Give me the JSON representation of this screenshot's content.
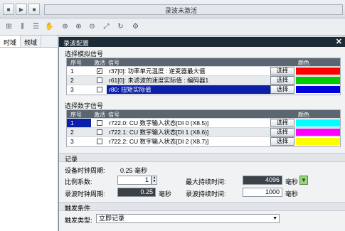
{
  "recording_status": "录波未激活",
  "left_tabs": [
    "时域",
    "频域"
  ],
  "dialog": {
    "title": "录波配置",
    "close": "✕",
    "analog": {
      "header": "选择模拟信号",
      "columns": {
        "num": "序号",
        "active": "激活",
        "signal": "信号",
        "color": "颜色"
      },
      "rows": [
        {
          "num": "1",
          "checked": "✓",
          "signal": "r37[0]: 功率单元温度 : 逆变器最大值",
          "button": "选择",
          "color": "#ff0000"
        },
        {
          "num": "2",
          "checked": "",
          "signal": "r61[0]: 未滤波的速度实际值 : 编码器1",
          "button": "选择",
          "color": "#00cc00"
        },
        {
          "num": "3",
          "checked": "",
          "signal": "r80: 扭矩实际值",
          "button": "选择",
          "color": "#0000dd"
        }
      ]
    },
    "digital": {
      "header": "选择数字信号",
      "columns": {
        "num": "序号",
        "active": "激活",
        "signal": "信号",
        "color": "颜色"
      },
      "rows": [
        {
          "num": "1",
          "checked": "",
          "signal": "r722.0: CU 数字输入状态[DI 0 (X8.5)]",
          "button": "选择",
          "color": "#00ffff"
        },
        {
          "num": "2",
          "checked": "",
          "signal": "r722.1: CU 数字输入状态[DI 1 (X8.6)]",
          "button": "选择",
          "color": "#ff00ff"
        },
        {
          "num": "3",
          "checked": "",
          "signal": "r722.2: CU 数字输入状态[DI 2 (X8.7)]",
          "button": "选择",
          "color": "#ffff00"
        }
      ]
    },
    "recording": {
      "header": "记录",
      "device_clock_label": "设备时钟周期:",
      "device_clock_value": "0.25 毫秒",
      "ratio_label": "比例系数:",
      "ratio_value": "1",
      "max_duration_label": "最大持续时间:",
      "max_duration_value": "4096",
      "max_duration_unit": "毫秒",
      "clock_cycle_label": "录波时钟周期:",
      "clock_cycle_value": "0.25",
      "clock_cycle_unit": "毫秒",
      "duration_label": "录波持续时间:",
      "duration_value": "1000",
      "duration_unit": "毫秒"
    },
    "trigger": {
      "header": "触发条件",
      "type_label": "触发类型:",
      "type_value": "立即记录"
    }
  }
}
